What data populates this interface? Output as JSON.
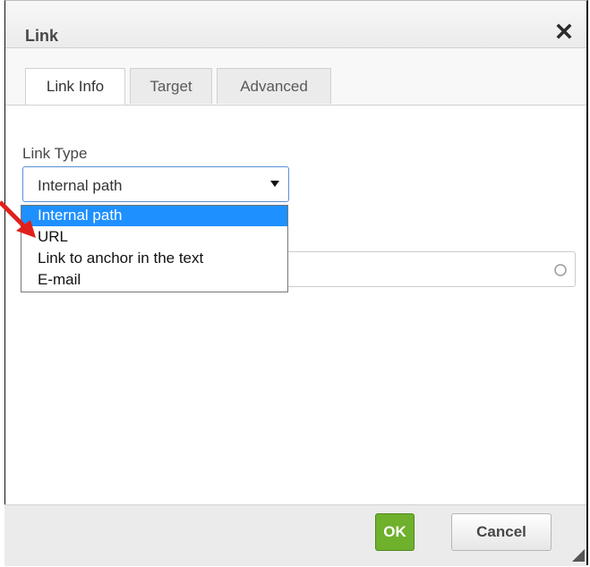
{
  "dialog": {
    "title": "Link"
  },
  "tabs": [
    {
      "label": "Link Info",
      "active": true
    },
    {
      "label": "Target",
      "active": false
    },
    {
      "label": "Advanced",
      "active": false
    }
  ],
  "link_type": {
    "label": "Link Type",
    "selected": "Internal path",
    "options": [
      "Internal path",
      "URL",
      "Link to anchor in the text",
      "E-mail"
    ]
  },
  "footer": {
    "ok_label": "OK",
    "cancel_label": "Cancel"
  },
  "colors": {
    "accent": "#1e90ff",
    "ok_button": "#6fb02c",
    "annotation_arrow": "#e0201b"
  },
  "icons": [
    "close-icon",
    "dropdown-arrow-icon",
    "circle-icon",
    "resize-handle-icon"
  ]
}
